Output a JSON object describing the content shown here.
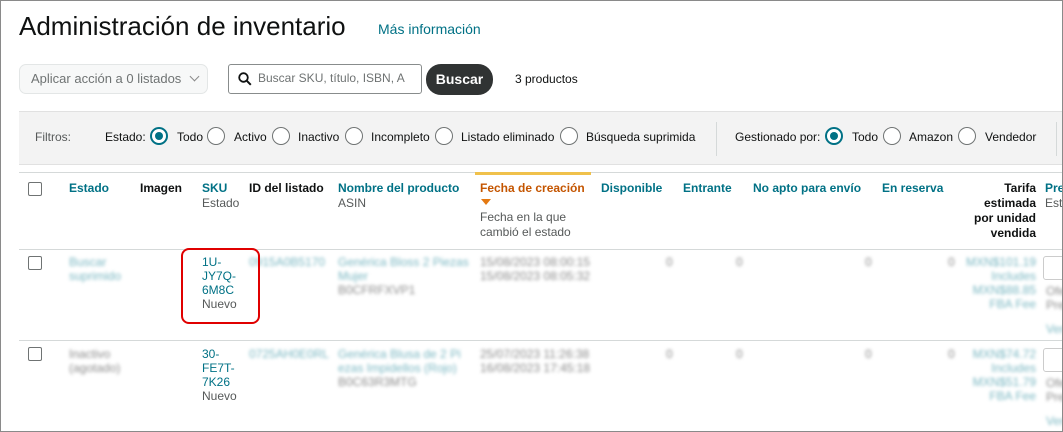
{
  "page": {
    "title": "Administración de inventario",
    "more_info": "Más información"
  },
  "toolbar": {
    "bulk_action": "Aplicar acción a 0 listados",
    "search_placeholder": "Buscar SKU, título, ISBN, A",
    "search_button": "Buscar",
    "product_count": "3 productos"
  },
  "filters": {
    "label": "Filtros:",
    "status_label": "Estado:",
    "status_options": [
      "Todo",
      "Activo",
      "Inactivo",
      "Incompleto",
      "Listado eliminado",
      "Búsqueda suprimida"
    ],
    "status_selected": "Todo",
    "fulfilled_label": "Gestionado por:",
    "fulfilled_options": [
      "Todo",
      "Amazon",
      "Vendedor"
    ],
    "fulfilled_selected": "Todo"
  },
  "table": {
    "headers": {
      "status": "Estado",
      "image": "Imagen",
      "sku": "SKU",
      "sku_sub": "Estado",
      "listing_id": "ID del listado",
      "product_name": "Nombre del producto",
      "product_sub": "ASIN",
      "created": "Fecha de creación",
      "created_sub1": "Fecha en la que",
      "created_sub2": "cambió el estado",
      "available": "Disponible",
      "inbound": "Entrante",
      "unfulfillable": "No apto para envío",
      "reserved": "En reserva",
      "fee1": "Tarifa",
      "fee2": "estimada",
      "fee3": "por unidad",
      "fee4": "vendida",
      "price": "Pre",
      "price_sub": "Est"
    },
    "rows": [
      {
        "status1": "Buscar",
        "status2": "suprimido",
        "sku1": "1U-",
        "sku2": "JY7Q-",
        "sku3": "6M8C",
        "condition": "Nuevo",
        "listing_id": "0915A0B5170",
        "name1": "Genérica Bloss 2 Piezas",
        "name2": "Mujer",
        "asin": "B0CFRFXVP1",
        "created1": "15/08/2023 08:00:15",
        "created2": "15/08/2023 08:05:32",
        "available": "0",
        "inbound": "0",
        "unfulfillable": "0",
        "reserved": "0",
        "fee1": "MXN$101.19",
        "fee2": "Includes",
        "fee3": "MXN$88.85",
        "fee4": "FBA Fee",
        "price_side": "Ofe",
        "price_side2": "Pre"
      },
      {
        "status1": "Inactivo",
        "status2": "(agotado)",
        "sku1": "30-",
        "sku2": "FE7T-",
        "sku3": "7K26",
        "condition": "Nuevo",
        "listing_id": "0725AH0E0RL",
        "name1": "Genérica Blusa de 2 Pi",
        "name2": "ezas Impidellos (Rojo)",
        "asin": "B0C63R3MTG",
        "created1": "25/07/2023 11:26:38",
        "created2": "16/08/2023 17:45:18",
        "available": "0",
        "inbound": "0",
        "unfulfillable": "0",
        "reserved": "0",
        "fee1": "MXN$74.72",
        "fee2": "Includes",
        "fee3": "MXN$51.79",
        "fee4": "FBA Fee",
        "price_side": "Ofe",
        "price_side2": "Pre"
      }
    ],
    "row1_extra": "Ver",
    "row2_extra": "Ver"
  }
}
